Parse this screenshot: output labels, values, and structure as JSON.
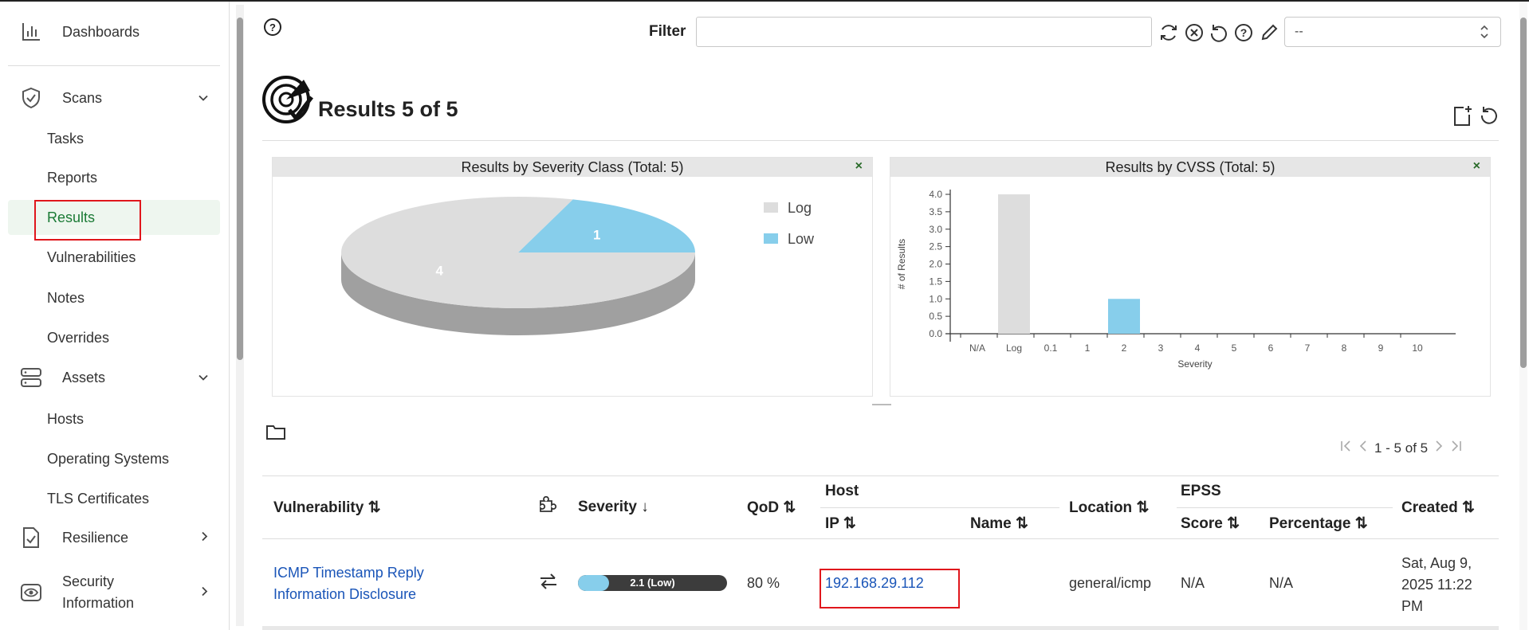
{
  "sidebar": {
    "dashboards": "Dashboards",
    "scans": "Scans",
    "scans_items": [
      "Tasks",
      "Reports",
      "Results",
      "Vulnerabilities",
      "Notes",
      "Overrides"
    ],
    "assets": "Assets",
    "assets_items": [
      "Hosts",
      "Operating Systems",
      "TLS Certificates"
    ],
    "resilience": "Resilience",
    "security_info_line1": "Security",
    "security_info_line2": "Information"
  },
  "toolbar": {
    "filter_label": "Filter",
    "filter_value": "",
    "select_value": "--"
  },
  "header": {
    "title": "Results 5 of 5"
  },
  "charts": {
    "severity_title": "Results by Severity Class (Total: 5)",
    "cvss_title": "Results by CVSS (Total: 5)",
    "close": "×"
  },
  "chart_data": [
    {
      "type": "pie",
      "title": "Results by Severity Class (Total: 5)",
      "categories": [
        "Log",
        "Low"
      ],
      "values": [
        4,
        1
      ],
      "colors": [
        "#dddddd",
        "#87ceeb"
      ],
      "legend": "top-right"
    },
    {
      "type": "bar",
      "title": "Results by CVSS (Total: 5)",
      "categories": [
        "N/A",
        "Log",
        "0.1",
        "1",
        "2",
        "3",
        "4",
        "5",
        "6",
        "7",
        "8",
        "9",
        "10"
      ],
      "values": [
        0,
        4,
        0,
        0,
        1,
        0,
        0,
        0,
        0,
        0,
        0,
        0,
        0
      ],
      "colors": [
        "#dddddd",
        "#dddddd",
        "#87ceeb",
        "#87ceeb",
        "#87ceeb",
        "#87ceeb",
        "#87ceeb",
        "#87ceeb",
        "#87ceeb",
        "#87ceeb",
        "#87ceeb",
        "#87ceeb",
        "#87ceeb"
      ],
      "xlabel": "Severity",
      "ylabel": "# of Results",
      "yticks": [
        "0.0",
        "0.5",
        "1.0",
        "1.5",
        "2.0",
        "2.5",
        "3.0",
        "3.5",
        "4.0"
      ],
      "ylim": [
        0,
        4
      ]
    }
  ],
  "pagination": {
    "text": "1 - 5 of 5"
  },
  "table": {
    "headers": {
      "vulnerability": "Vulnerability ⇅",
      "severity": "Severity ↓",
      "qod": "QoD ⇅",
      "host": "Host",
      "ip": "IP ⇅",
      "name": "Name ⇅",
      "location": "Location ⇅",
      "epss": "EPSS",
      "score": "Score ⇅",
      "percentage": "Percentage ⇅",
      "created": "Created ⇅"
    },
    "rows": [
      {
        "vulnerability_line1": "ICMP Timestamp Reply",
        "vulnerability_line2": "Information Disclosure",
        "severity_label": "2.1 (Low)",
        "severity_value": 2.1,
        "qod": "80 %",
        "ip": "192.168.29.112",
        "name": "",
        "location": "general/icmp",
        "epss_score": "N/A",
        "epss_percentage": "N/A",
        "created_line1": "Sat, Aug 9,",
        "created_line2": "2025 11:22",
        "created_line3": "PM"
      }
    ]
  }
}
